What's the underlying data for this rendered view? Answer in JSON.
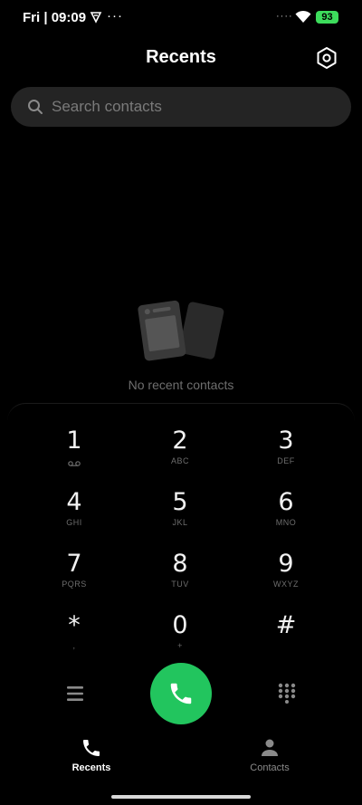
{
  "status_bar": {
    "time": "Fri | 09:09",
    "more": "···",
    "extra_dots": "····",
    "battery": "93"
  },
  "header": {
    "title": "Recents",
    "settings_icon": "settings-hexagon-icon"
  },
  "search": {
    "placeholder": "Search contacts"
  },
  "empty_state": {
    "text": "No recent contacts"
  },
  "dialpad": {
    "keys": [
      {
        "digit": "1",
        "letters": ""
      },
      {
        "digit": "2",
        "letters": "ABC"
      },
      {
        "digit": "3",
        "letters": "DEF"
      },
      {
        "digit": "4",
        "letters": "GHI"
      },
      {
        "digit": "5",
        "letters": "JKL"
      },
      {
        "digit": "6",
        "letters": "MNO"
      },
      {
        "digit": "7",
        "letters": "PQRS"
      },
      {
        "digit": "8",
        "letters": "TUV"
      },
      {
        "digit": "9",
        "letters": "WXYZ"
      },
      {
        "digit": "*",
        "letters": ","
      },
      {
        "digit": "0",
        "letters": "+"
      },
      {
        "digit": "#",
        "letters": ""
      }
    ],
    "call_color": "#22c55e"
  },
  "bottom_nav": {
    "recents": "Recents",
    "contacts": "Contacts"
  }
}
